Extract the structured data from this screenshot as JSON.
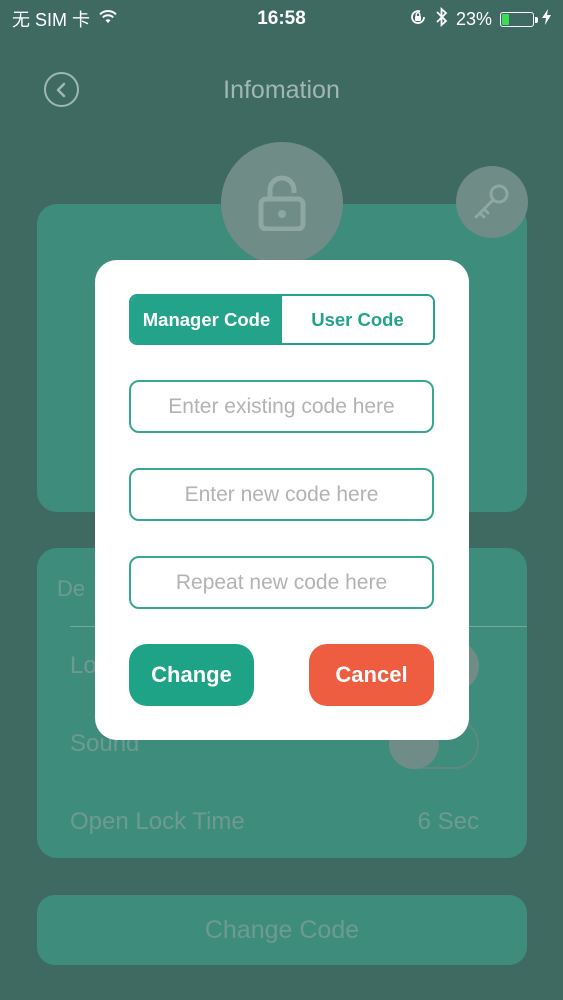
{
  "status_bar": {
    "carrier": "无 SIM 卡",
    "time": "16:58",
    "battery": "23%",
    "battery_level": 0.23
  },
  "header": {
    "title": "Infomation"
  },
  "settings": {
    "heading": "De",
    "lock_label": "Lo",
    "sound_label": "Sound",
    "open_lock_time_label": "Open Lock Time",
    "open_lock_time_value": "6 Sec"
  },
  "change_code_label": "Change Code",
  "modal": {
    "tabs": [
      {
        "label": "Manager Code",
        "active": true
      },
      {
        "label": "User Code",
        "active": false
      }
    ],
    "existing_placeholder": "Enter existing code here",
    "new_placeholder": "Enter new code here",
    "repeat_placeholder": "Repeat new code here",
    "change_label": "Change",
    "cancel_label": "Cancel"
  },
  "colors": {
    "accent": "#23a389",
    "cancel": "#ee5d40",
    "battery": "#3ddc55"
  }
}
